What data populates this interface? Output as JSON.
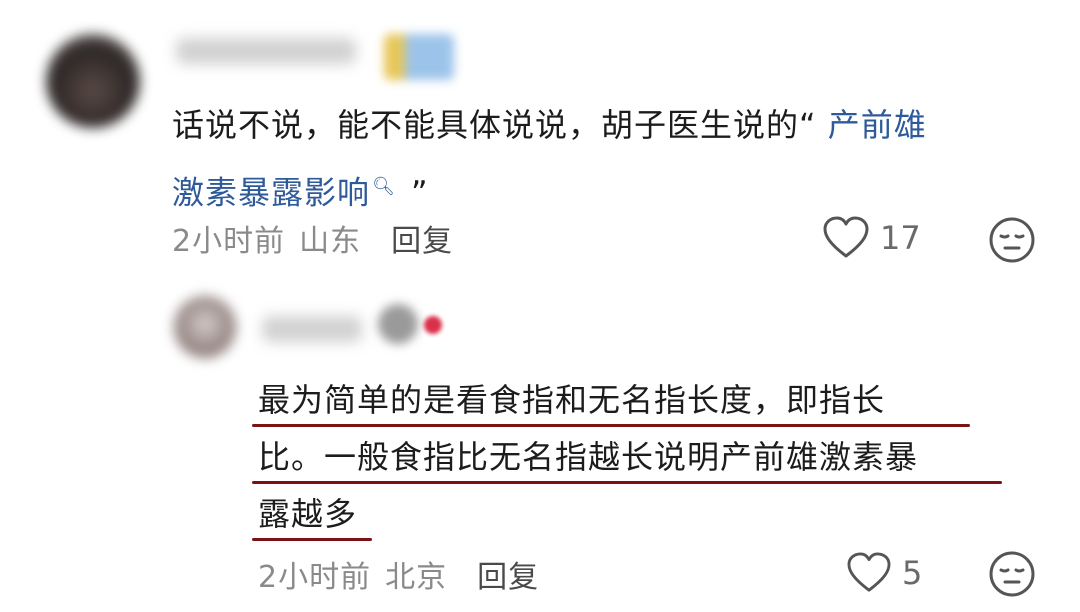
{
  "comment1": {
    "text_before": "话说不说，能不能具体说说，胡子医生说的“",
    "link_line1": " 产前雄",
    "link_line2": "激素暴露影响",
    "text_after": " ”",
    "time": "2小时前",
    "location": "山东",
    "reply_label": "回复",
    "like_count": "17"
  },
  "comment2": {
    "line1": "最为简单的是看食指和无名指长度，即指长",
    "line2": "比。一般食指比无名指越长说明产前雄激素暴",
    "line3": "露越多",
    "time": "2小时前",
    "location": "北京",
    "reply_label": "回复",
    "like_count": "5"
  },
  "icons": {
    "like": "heart-outline-icon",
    "emoji": "neutral-face-icon",
    "search": "search-icon"
  },
  "colors": {
    "underline": "#7a1414",
    "link": "#2f5a9a"
  }
}
